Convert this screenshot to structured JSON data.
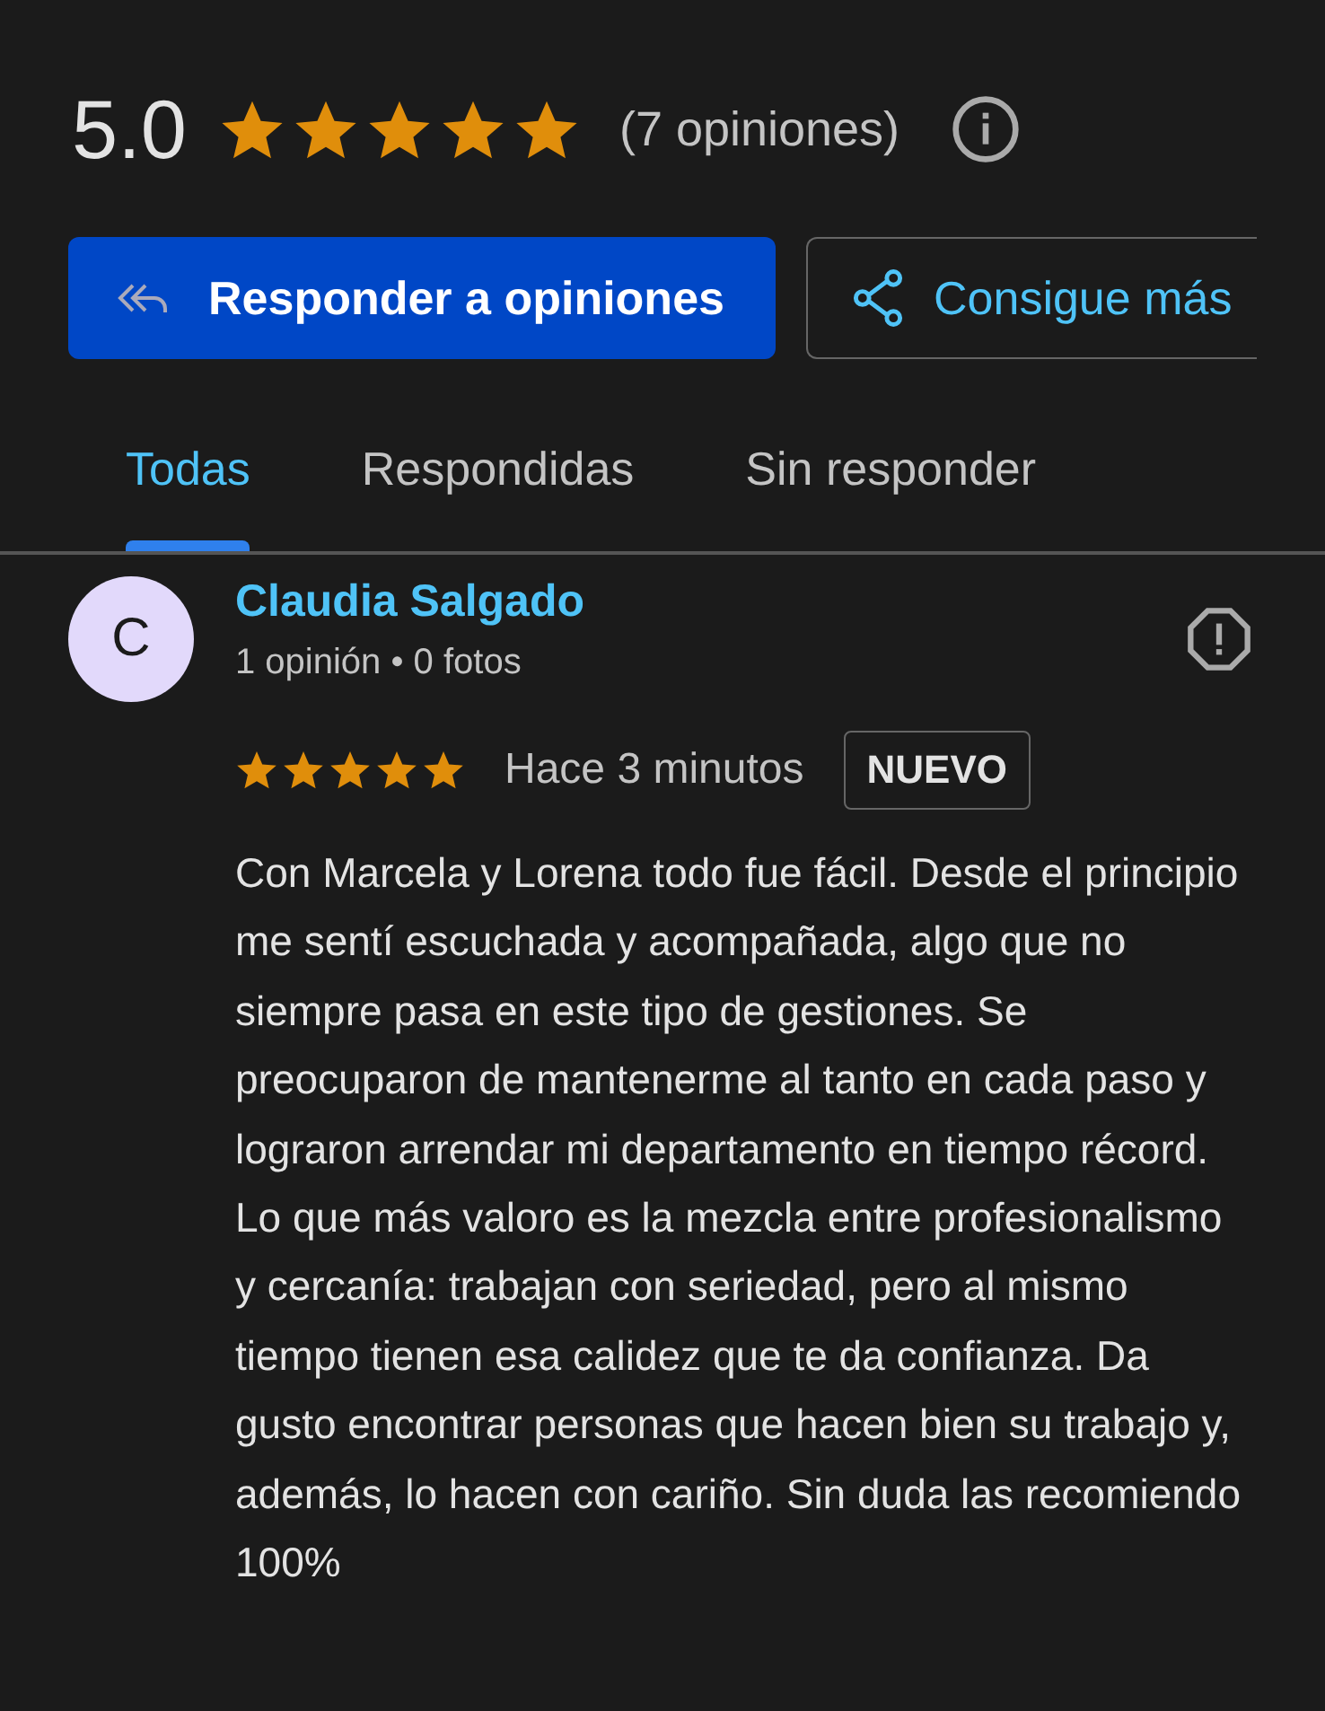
{
  "summary": {
    "rating": "5.0",
    "stars": 5,
    "count": "(7 opiniones)"
  },
  "actions": [
    {
      "kind": "primary",
      "label": "Responder a opiniones"
    },
    {
      "kind": "share",
      "label": "Consigue más"
    }
  ],
  "tabs": [
    {
      "label": "Todas",
      "selected": true
    },
    {
      "label": "Respondidas",
      "selected": false
    },
    {
      "label": "Sin responder",
      "selected": false
    }
  ],
  "review": {
    "initial": "C",
    "author": "Claudia Salgado",
    "meta": "1 opinión • 0 fotos",
    "stars": 5,
    "time": "Hace 3 minutos",
    "badge": "NUEVO",
    "text": "Con Marcela y Lorena todo fue fácil. Desde el principio me sentí escuchada y acompañada, algo que no siempre pasa en este tipo de gestiones. Se preocuparon de mantenerme al tanto en cada paso y lograron arrendar mi departamento en tiempo récord. Lo que más valoro es la mezcla entre profesionalismo y cercanía: trabajan con seriedad, pero al mismo tiempo tienen esa calidez que te da confianza. Da gusto encontrar personas que hacen bien su trabajo y, además, lo hacen con cariño. Sin duda las recomiendo 100%"
  }
}
